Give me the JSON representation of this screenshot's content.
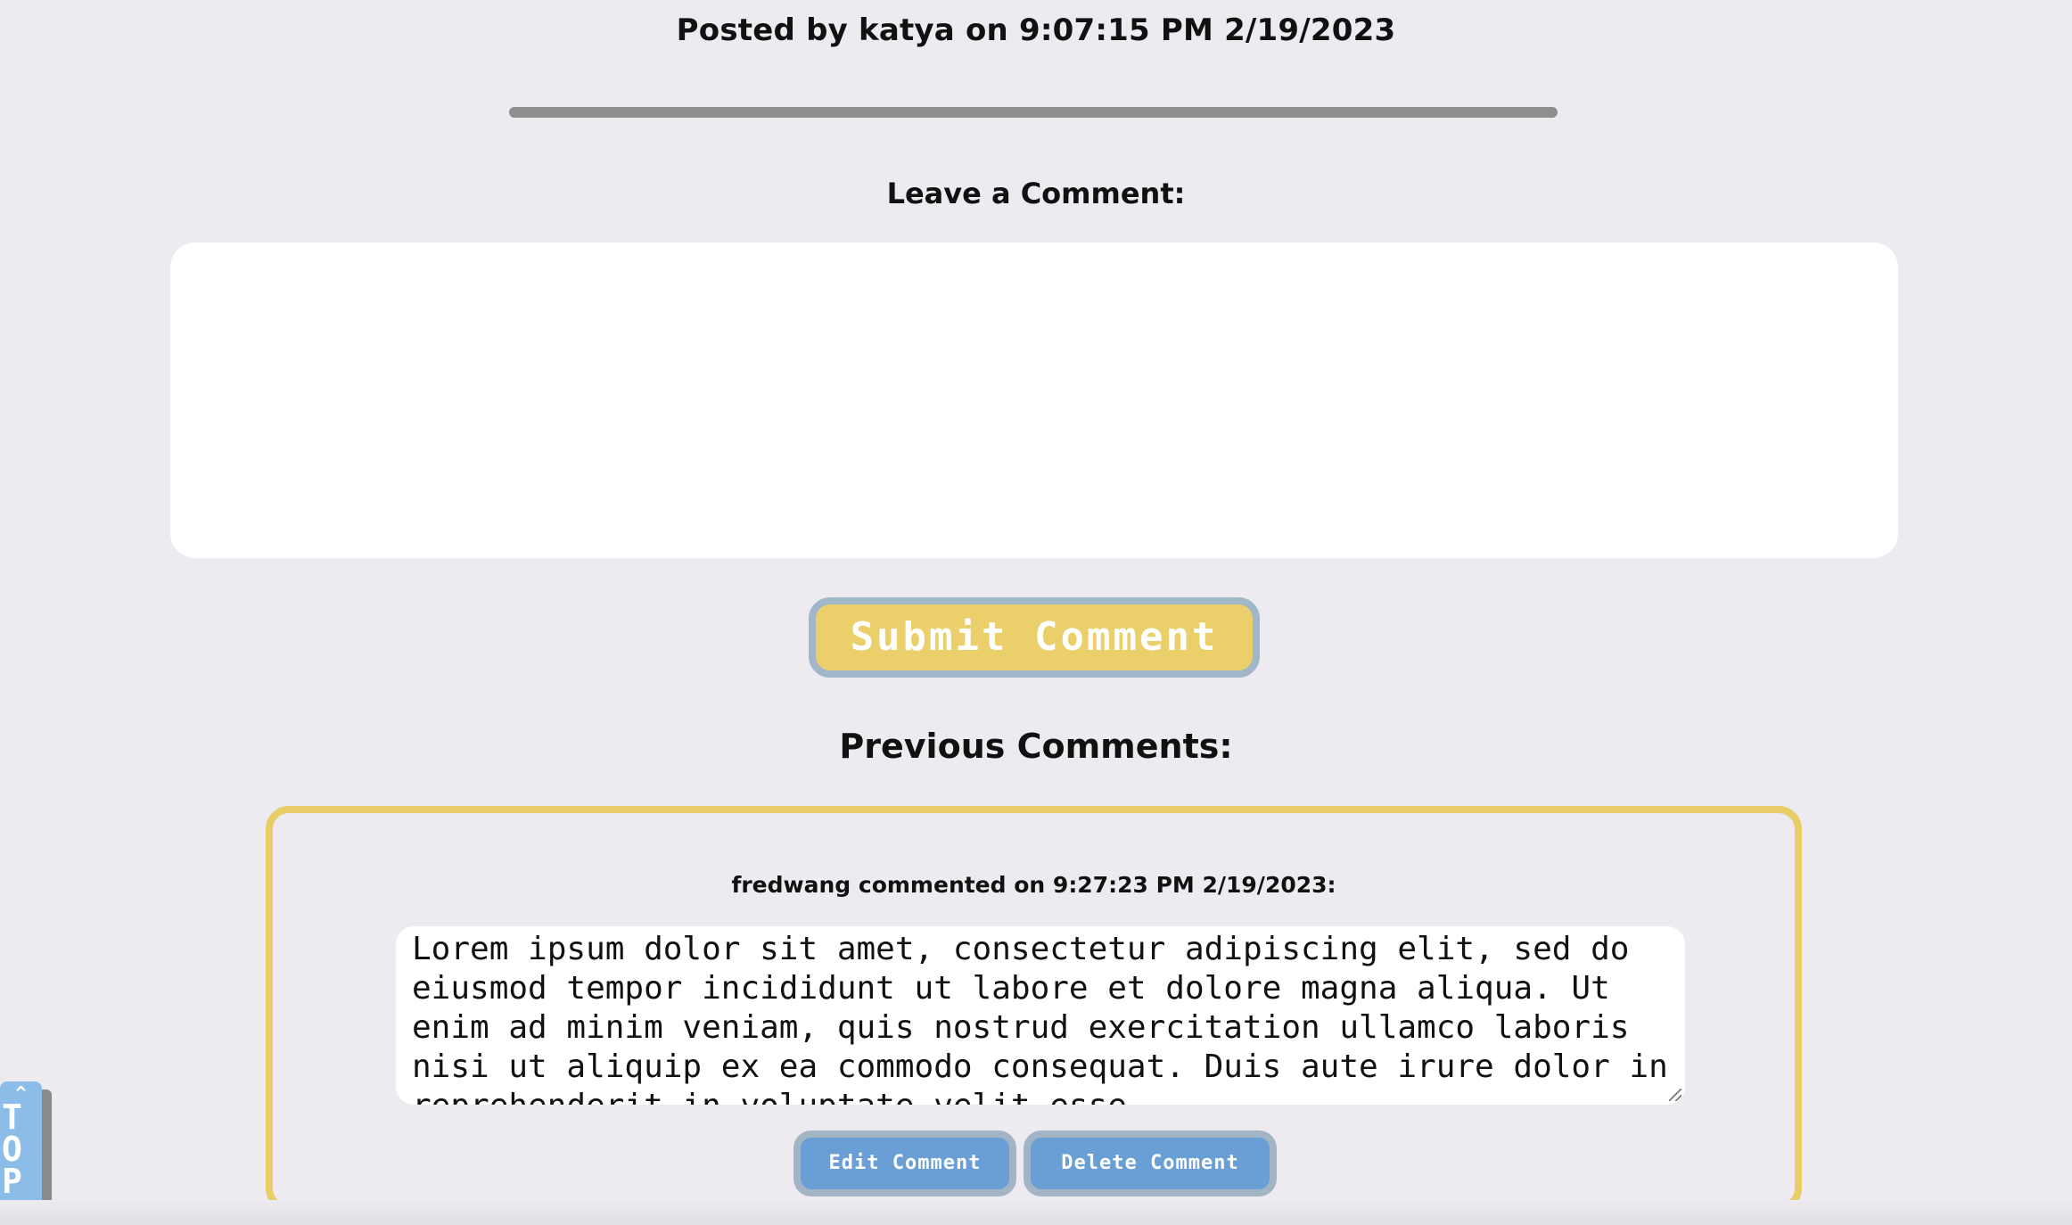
{
  "post": {
    "posted_by_text": "Posted by katya on 9:07:15 PM 2/19/2023"
  },
  "comment_form": {
    "label": "Leave a Comment:",
    "input_value": "",
    "submit_label": "Submit Comment"
  },
  "previous_comments": {
    "heading": "Previous Comments:",
    "items": [
      {
        "meta": "fredwang commented on 9:27:23 PM 2/19/2023:",
        "text": "Lorem ipsum dolor sit amet, consectetur adipiscing elit, sed do eiusmod tempor incididunt ut labore et dolore magna aliqua. Ut enim ad minim veniam, quis nostrud exercitation ullamco laboris nisi ut aliquip ex ea commodo consequat. Duis aute irure dolor in reprehenderit in voluptate velit esse",
        "edit_label": "Edit Comment",
        "delete_label": "Delete Comment"
      }
    ]
  },
  "scroll_top": {
    "arrow": "^",
    "label": "TOP"
  },
  "colors": {
    "background": "#edeaf0",
    "accent_yellow": "#eacf6a",
    "button_blue": "#6a9fd5",
    "button_border": "#a3b5c5",
    "divider": "#8e8e8e"
  }
}
